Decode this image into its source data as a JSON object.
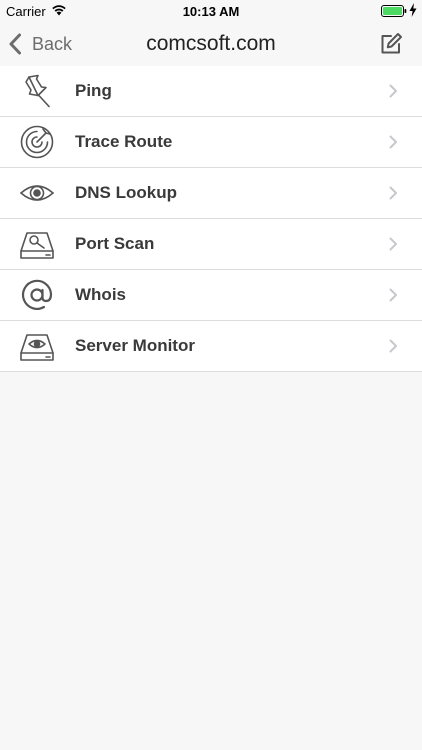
{
  "status_bar": {
    "carrier": "Carrier",
    "time": "10:13 AM",
    "battery_color": "#4cd964"
  },
  "nav": {
    "back_label": "Back",
    "title": "comcsoft.com"
  },
  "menu": {
    "items": [
      {
        "label": "Ping",
        "icon": "pushpin-icon"
      },
      {
        "label": "Trace Route",
        "icon": "radar-icon"
      },
      {
        "label": "DNS Lookup",
        "icon": "eye-icon"
      },
      {
        "label": "Port Scan",
        "icon": "drive-search-icon"
      },
      {
        "label": "Whois",
        "icon": "at-sign-icon"
      },
      {
        "label": "Server Monitor",
        "icon": "drive-eye-icon"
      }
    ]
  },
  "colors": {
    "background": "#f7f7f7",
    "row_background": "#ffffff",
    "separator": "#dcdcdc",
    "icon_stroke": "#555555",
    "chevron": "#c7c7cc"
  }
}
